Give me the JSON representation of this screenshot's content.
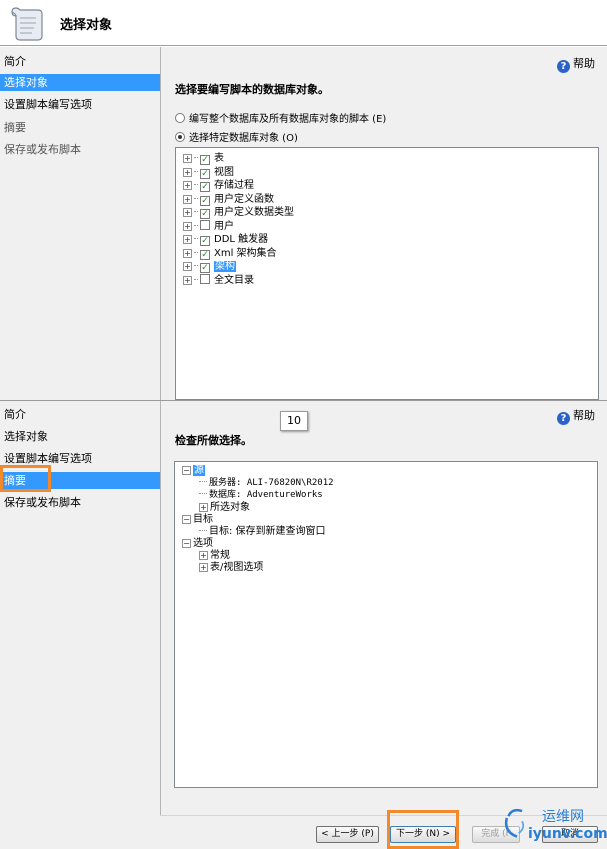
{
  "window": {
    "title": "选择对象"
  },
  "top": {
    "sidebar": [
      {
        "label": "简介",
        "state": "normal"
      },
      {
        "label": "选择对象",
        "state": "active"
      },
      {
        "label": "设置脚本编写选项",
        "state": "normal"
      },
      {
        "label": "摘要",
        "state": "disabled"
      },
      {
        "label": "保存或发布脚本",
        "state": "disabled"
      }
    ],
    "help_label": "帮助",
    "heading": "选择要编写脚本的数据库对象。",
    "radio_all": "编写整个数据库及所有数据库对象的脚本 (E)",
    "radio_specific": "选择特定数据库对象 (O)",
    "objects": [
      {
        "label": "表",
        "checked": true,
        "selected": false
      },
      {
        "label": "视图",
        "checked": true,
        "selected": false
      },
      {
        "label": "存储过程",
        "checked": true,
        "selected": false
      },
      {
        "label": "用户定义函数",
        "checked": true,
        "selected": false
      },
      {
        "label": "用户定义数据类型",
        "checked": true,
        "selected": false
      },
      {
        "label": "用户",
        "checked": false,
        "selected": false
      },
      {
        "label": "DDL 触发器",
        "checked": true,
        "selected": false
      },
      {
        "label": "Xml 架构集合",
        "checked": true,
        "selected": false
      },
      {
        "label": "架构",
        "checked": true,
        "selected": true
      },
      {
        "label": "全文目录",
        "checked": false,
        "selected": false
      }
    ]
  },
  "bottom": {
    "sidebar": [
      {
        "label": "简介",
        "state": "normal"
      },
      {
        "label": "选择对象",
        "state": "normal"
      },
      {
        "label": "设置脚本编写选项",
        "state": "normal"
      },
      {
        "label": "摘要",
        "state": "active"
      },
      {
        "label": "保存或发布脚本",
        "state": "normal"
      }
    ],
    "help_label": "帮助",
    "step_badge": "10",
    "heading": "检查所做选择。",
    "summary": {
      "source": "源",
      "server": "服务器: ALI-76820N\\R2012",
      "database": "数据库: AdventureWorks",
      "selected_objects": "所选对象",
      "target": "目标",
      "target_value": "目标: 保存到新建查询窗口",
      "options": "选项",
      "general": "常规",
      "table_view_options": "表/视图选项"
    },
    "buttons": {
      "previous": "< 上一步 (P)",
      "next": "下一步 (N) >",
      "finish": "完成 (F",
      "cancel": "取消"
    }
  },
  "watermark": {
    "cn": "运维网",
    "en": "iyunv.com"
  },
  "colors": {
    "selection": "#3399ff",
    "highlight": "#f08a2c",
    "panel": "#f0f0f0"
  }
}
